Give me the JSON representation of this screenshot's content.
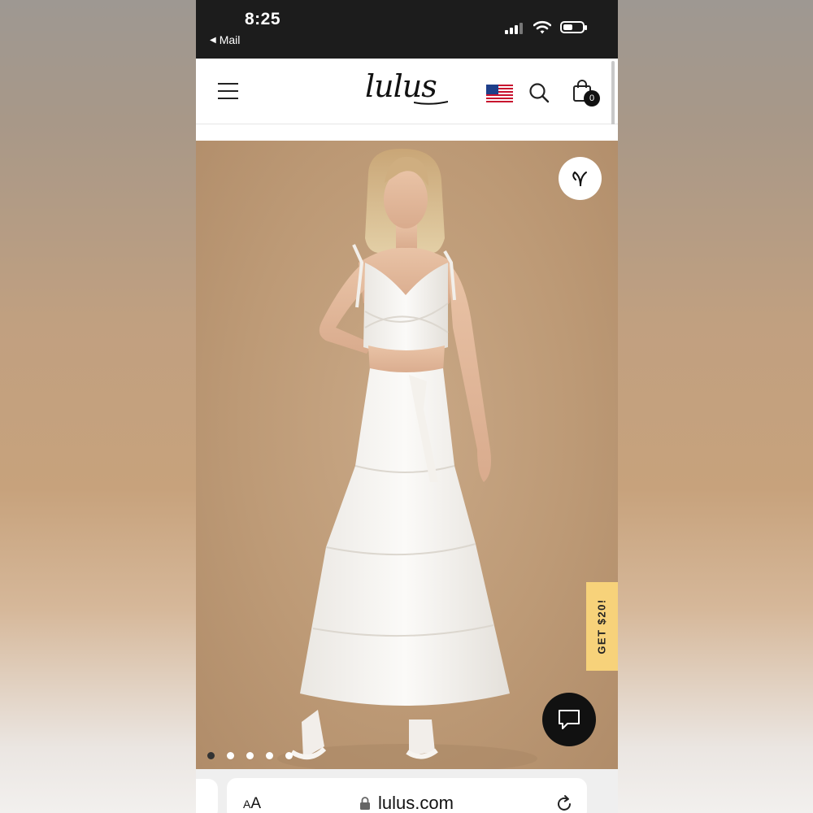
{
  "status_bar": {
    "time": "8:25",
    "back_label": "Mail"
  },
  "header": {
    "logo": "lulus",
    "region_flag": "us-flag-icon",
    "cart_count": "0"
  },
  "product": {
    "image": "model wearing white wrap crop top and tiered white maxi skirt",
    "carousel": {
      "total_dots": 5,
      "active_index": 0
    }
  },
  "promo": {
    "label": "GET $20!"
  },
  "browser": {
    "text_size_label_small": "A",
    "text_size_label_large": "A",
    "domain": "lulus.com"
  },
  "colors": {
    "status_bar_bg": "#1c1c1c",
    "promo_bg": "#f7d27a",
    "chat_bg": "#111111",
    "photo_bg": "#c0a07d"
  },
  "icons": [
    "menu-icon",
    "search-icon",
    "shopping-bag-icon",
    "heart-icon",
    "chat-icon",
    "lock-icon",
    "reload-icon"
  ]
}
